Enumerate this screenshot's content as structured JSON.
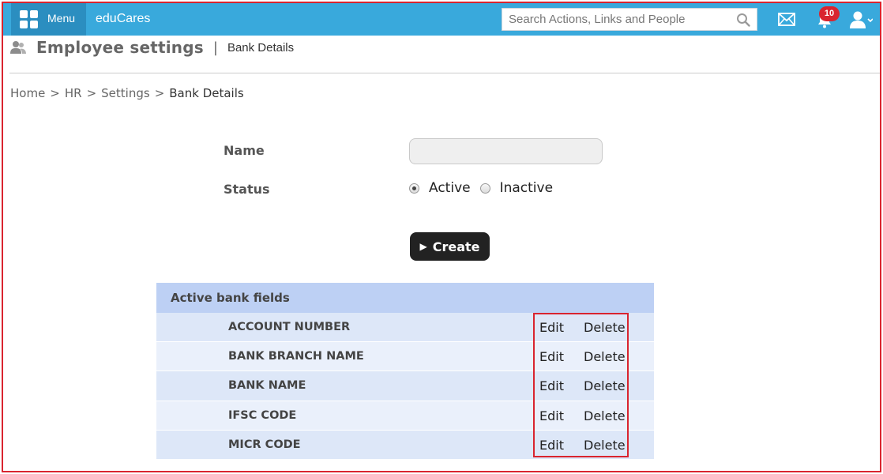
{
  "topbar": {
    "menu_label": "Menu",
    "brand": "eduCares",
    "search_placeholder": "Search Actions, Links and People",
    "notification_count": "10",
    "color": "#39a9dc"
  },
  "page": {
    "title": "Employee settings",
    "separator": "|",
    "subtitle": "Bank Details"
  },
  "breadcrumb": {
    "items": [
      "Home",
      "HR",
      "Settings",
      "Bank Details"
    ],
    "separator": ">"
  },
  "form": {
    "name_label": "Name",
    "name_value": "",
    "status_label": "Status",
    "status_options": [
      "Active",
      "Inactive"
    ],
    "status_selected": "Active",
    "create_label": "Create"
  },
  "table": {
    "header": "Active bank fields",
    "edit_label": "Edit",
    "delete_label": "Delete",
    "rows": [
      "ACCOUNT NUMBER",
      "BANK BRANCH NAME",
      "BANK NAME",
      "IFSC CODE",
      "MICR CODE"
    ]
  }
}
